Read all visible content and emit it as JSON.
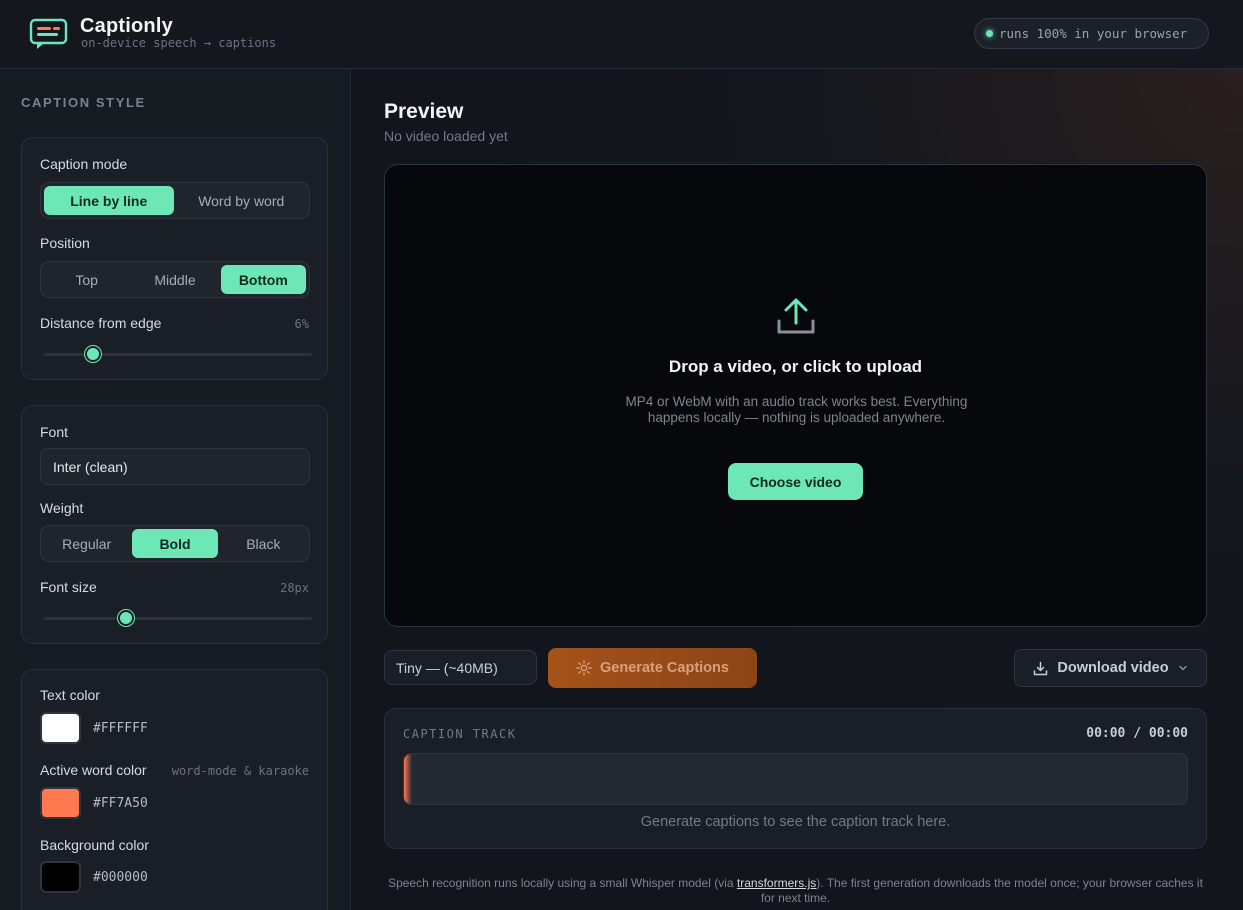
{
  "header": {
    "brand": "Captionly",
    "tagline": "on-device speech → captions",
    "badge": "runs 100% in your browser"
  },
  "sidebar": {
    "section_title": "CAPTION STYLE",
    "caption_mode": {
      "label": "Caption mode",
      "options": [
        "Line by line",
        "Word by word"
      ],
      "selected": "Line by line"
    },
    "position": {
      "label": "Position",
      "options": [
        "Top",
        "Middle",
        "Bottom"
      ],
      "selected": "Bottom"
    },
    "distance": {
      "label": "Distance from edge",
      "value_text": "6%",
      "value_fraction": 0.17
    },
    "font": {
      "label": "Font",
      "value": "Inter (clean)"
    },
    "weight": {
      "label": "Weight",
      "options": [
        "Regular",
        "Bold",
        "Black"
      ],
      "selected": "Bold"
    },
    "font_size": {
      "label": "Font size",
      "value_text": "28px",
      "value_fraction": 0.3
    },
    "text_color": {
      "label": "Text color",
      "hex": "#FFFFFF"
    },
    "active_word_color": {
      "label": "Active word color",
      "hint": "word-mode & karaoke",
      "hex": "#FF7A50"
    },
    "background_color": {
      "label": "Background color",
      "hex": "#000000"
    }
  },
  "main": {
    "title": "Preview",
    "subtitle": "No video loaded yet",
    "dropzone": {
      "title": "Drop a video, or click to upload",
      "description": "MP4 or WebM with an audio track works best. Everything happens locally — nothing is uploaded anywhere.",
      "button": "Choose video"
    },
    "model_select": "Tiny — (~40MB)",
    "generate_button": "Generate Captions",
    "download_button": "Download video",
    "caption_track": {
      "title": "CAPTION TRACK",
      "time": "00:00 / 00:00",
      "empty_text": "Generate captions to see the caption track here."
    },
    "footnote_before": "Speech recognition runs locally using a small Whisper model (via ",
    "footnote_link": "transformers.js",
    "footnote_after": "). The first generation downloads the model once; your browser caches it for next time."
  },
  "colors": {
    "accent": "#6ee7b7",
    "generate": "#a55218",
    "active_word": "#FF7A50"
  },
  "icons": {
    "logo": "caption-bubble-icon",
    "upload": "upload-icon",
    "generate": "sparkle-icon",
    "download": "download-icon",
    "chevron": "chevron-down-icon"
  }
}
